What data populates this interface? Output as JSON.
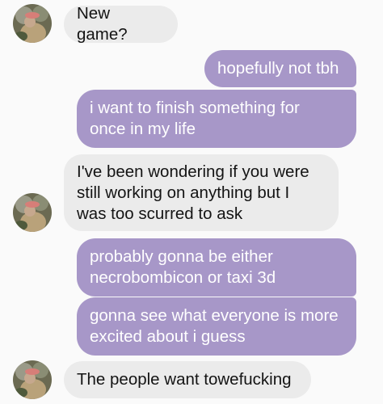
{
  "colors": {
    "background": "#fafafa",
    "incoming_bubble": "#ebebeb",
    "incoming_text": "#141414",
    "outgoing_bubble": "#a797c8",
    "outgoing_text": "#ffffff"
  },
  "contact": {
    "avatar_icon": "contact-avatar-photo"
  },
  "messages": [
    {
      "direction": "incoming",
      "text": "New game?"
    },
    {
      "direction": "outgoing",
      "text": "hopefully not tbh"
    },
    {
      "direction": "outgoing",
      "text": "i want to finish something for\nonce in my life"
    },
    {
      "direction": "incoming",
      "text": "I've been wondering if you were\nstill working on anything but I\nwas too scurred to ask"
    },
    {
      "direction": "outgoing",
      "text": "probably gonna be either\nnecrobombicon or taxi 3d"
    },
    {
      "direction": "outgoing",
      "text": "gonna see what everyone is more\nexcited about i guess"
    },
    {
      "direction": "incoming",
      "text": "The people want towefucking"
    }
  ]
}
